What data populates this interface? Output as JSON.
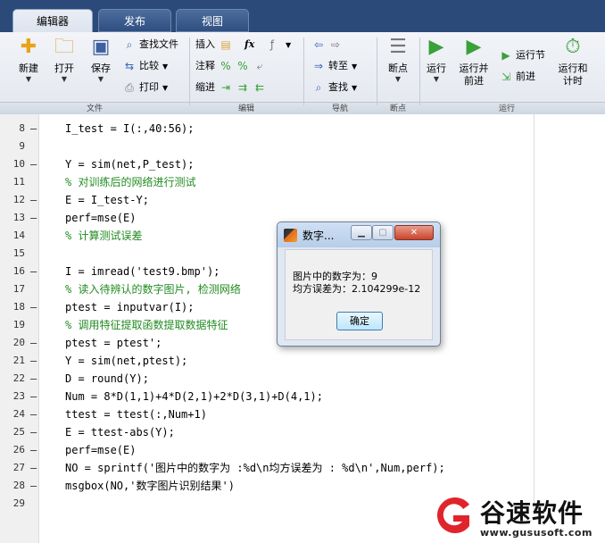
{
  "tabs": [
    "编辑器",
    "发布",
    "视图"
  ],
  "ribbon": {
    "file": {
      "label": "文件",
      "new": "新建",
      "open": "打开",
      "save": "保存",
      "find_files": "查找文件",
      "compare": "比较",
      "print": "打印"
    },
    "edit": {
      "label": "编辑",
      "insert": "插入",
      "comment": "注释",
      "indent": "缩进",
      "fx": "fx"
    },
    "nav": {
      "label": "导航",
      "goto": "转至",
      "find": "查找"
    },
    "breakpoints": {
      "label": "断点",
      "button": "断点"
    },
    "run": {
      "label": "运行",
      "run": "运行",
      "run_advance": "运行并\n前进",
      "run_section": "运行节",
      "advance": "前进",
      "run_time": "运行和\n计时"
    }
  },
  "editor": {
    "lines": [
      {
        "n": "8",
        "dash": true,
        "code": "I_test = I(:,40:56);",
        "type": "code"
      },
      {
        "n": "9",
        "dash": false,
        "code": "",
        "type": "code"
      },
      {
        "n": "10",
        "dash": true,
        "code": "Y = sim(net,P_test);",
        "type": "code"
      },
      {
        "n": "11",
        "dash": false,
        "code": "% 对训练后的网络进行测试",
        "type": "comment"
      },
      {
        "n": "12",
        "dash": true,
        "code": "E = I_test-Y;",
        "type": "code"
      },
      {
        "n": "13",
        "dash": true,
        "code": "perf=mse(E)",
        "type": "code"
      },
      {
        "n": "14",
        "dash": false,
        "code": "% 计算测试误差",
        "type": "comment"
      },
      {
        "n": "15",
        "dash": false,
        "code": "",
        "type": "code"
      },
      {
        "n": "16",
        "dash": true,
        "code": "I = imread('test9.bmp');",
        "type": "code"
      },
      {
        "n": "17",
        "dash": false,
        "code": "% 读入待辨认的数字图片, 检测网络",
        "type": "comment"
      },
      {
        "n": "18",
        "dash": true,
        "code": "ptest = inputvar(I);",
        "type": "code"
      },
      {
        "n": "19",
        "dash": false,
        "code": "% 调用特征提取函数提取数据特征",
        "type": "comment"
      },
      {
        "n": "20",
        "dash": true,
        "code": "ptest = ptest';",
        "type": "code"
      },
      {
        "n": "21",
        "dash": true,
        "code": "Y = sim(net,ptest);",
        "type": "code"
      },
      {
        "n": "22",
        "dash": true,
        "code": "D = round(Y);",
        "type": "code"
      },
      {
        "n": "23",
        "dash": true,
        "code": "Num = 8*D(1,1)+4*D(2,1)+2*D(3,1)+D(4,1);",
        "type": "code"
      },
      {
        "n": "24",
        "dash": true,
        "code": "ttest = ttest(:,Num+1)",
        "type": "code"
      },
      {
        "n": "25",
        "dash": true,
        "code": "E = ttest-abs(Y);",
        "type": "code"
      },
      {
        "n": "26",
        "dash": true,
        "code": "perf=mse(E)",
        "type": "code"
      },
      {
        "n": "27",
        "dash": true,
        "code": "NO = sprintf('图片中的数字为 :%d\\n均方误差为 : %d\\n',Num,perf);",
        "type": "code"
      },
      {
        "n": "28",
        "dash": true,
        "code": "msgbox(NO,'数字图片识别结果')",
        "type": "code"
      },
      {
        "n": "29",
        "dash": false,
        "code": "",
        "type": "code"
      }
    ]
  },
  "dialog": {
    "title": "数字...",
    "line1": "图片中的数字为：9",
    "line2": "均方误差为：2.104299e-12",
    "ok": "确定"
  },
  "watermark": {
    "name": "谷速软件",
    "url": "www.gususoft.com"
  },
  "colors": {
    "tab_bar": "#2b4a7a",
    "comment": "#228b22",
    "string": "#a020f0",
    "watermark_red": "#e0242b"
  }
}
